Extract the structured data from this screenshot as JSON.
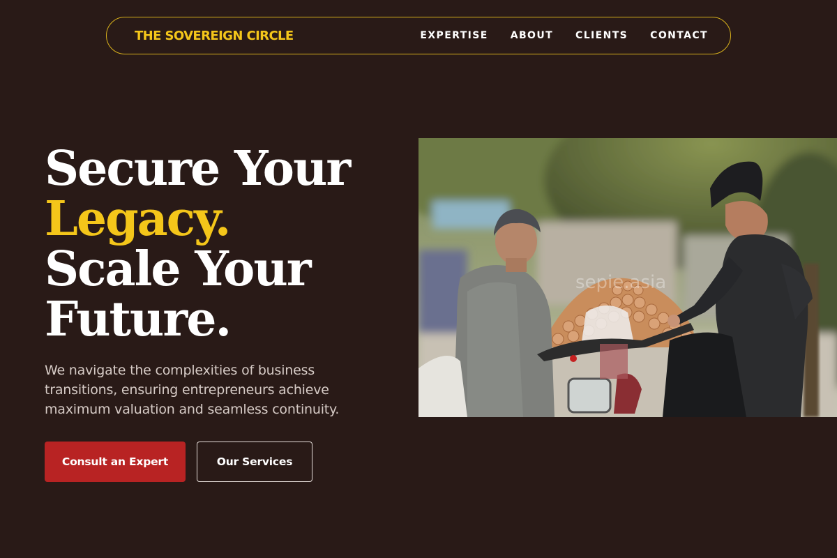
{
  "nav": {
    "brand": "THE SOVEREIGN CIRCLE",
    "links": [
      "EXPERTISE",
      "ABOUT",
      "CLIENTS",
      "CONTACT"
    ]
  },
  "hero": {
    "title_lines": [
      "Secure Your",
      "Legacy.",
      "Scale Your",
      "Future."
    ],
    "subtitle": "We navigate the complexities of business transitions, ensuring entrepreneurs achieve maximum valuation and seamless continuity.",
    "primary_button": "Consult an Expert",
    "secondary_button": "Our Services",
    "image_watermark": "sepie.asia"
  },
  "colors": {
    "background": "#291a17",
    "accent": "#f4c61a",
    "button_primary": "#b82323",
    "text": "#ffffff"
  }
}
